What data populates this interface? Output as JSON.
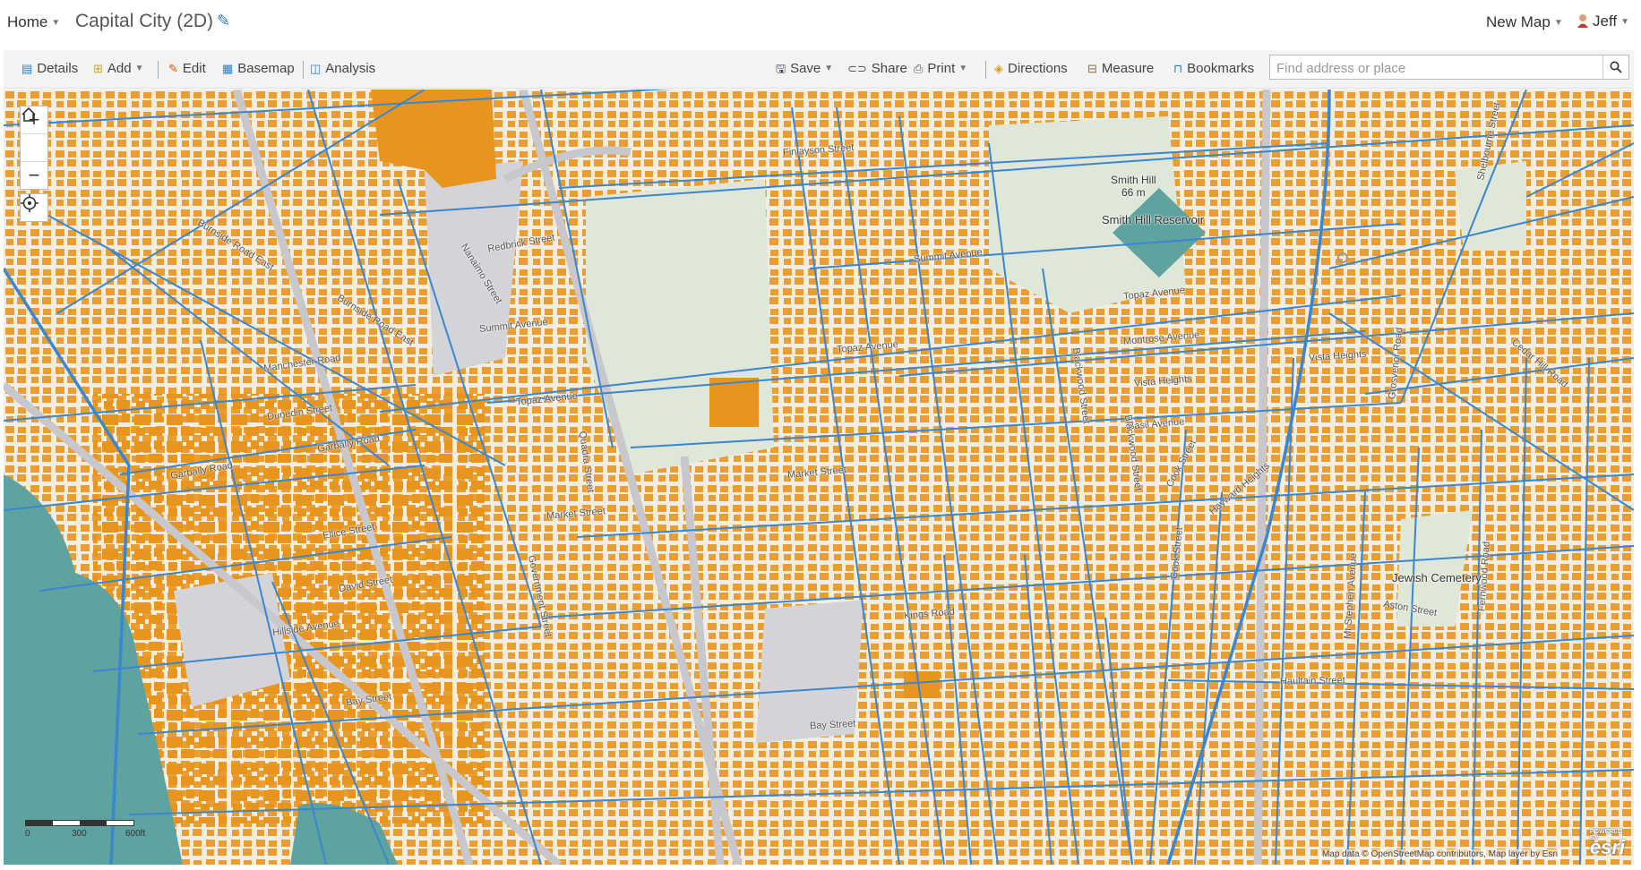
{
  "topbar": {
    "home_label": "Home",
    "map_title": "Capital City (2D)",
    "new_map_label": "New Map",
    "user_name": "Jeff"
  },
  "toolbar": {
    "details": "Details",
    "add": "Add",
    "edit": "Edit",
    "basemap": "Basemap",
    "analysis": "Analysis",
    "save": "Save",
    "share": "Share",
    "print": "Print",
    "directions": "Directions",
    "measure": "Measure",
    "bookmarks": "Bookmarks",
    "search_placeholder": "Find address or place"
  },
  "map": {
    "colors": {
      "land": "#f2ede2",
      "building": "#e8951f",
      "road": "#3a86d1",
      "water": "#5ea3a0",
      "park": "#dfe8d8",
      "paved": "#d4d4d8"
    },
    "features": {
      "smith_hill": "Smith Hill",
      "smith_hill_elev": "66 m",
      "reservoir": "Smith Hill Reservoir",
      "cemetery": "Jewish Cemetery"
    },
    "street_labels": [
      "Finlayson Street",
      "Summit Avenue",
      "Topaz Avenue",
      "Montrose Avenue",
      "Vista Heights",
      "Basil Avenue",
      "Market Street",
      "Kings Road",
      "Bay Street",
      "Hillside Avenue",
      "Burnside Road East",
      "Garbally Road",
      "Dunedin Street",
      "Manchester Road",
      "Ellice Street",
      "David Street",
      "Government Street",
      "Blackwood Street",
      "Cook Street",
      "Shelbourne Street",
      "Haultain Street",
      "Aston Street",
      "Fernwood Road",
      "Grosvenor Road",
      "Cedar Hill Road",
      "Redbrick Street",
      "Nanaimo Street",
      "Quadra Street",
      "Hayward Heights",
      "Mt Stephen Avenue"
    ],
    "scale": {
      "zero": "0",
      "mid": "300",
      "max": "600ft"
    },
    "attribution": "Map data © OpenStreetMap contributors, Map layer by Esri",
    "esri_powered": "POWERED BY",
    "esri_logo": "esri"
  }
}
